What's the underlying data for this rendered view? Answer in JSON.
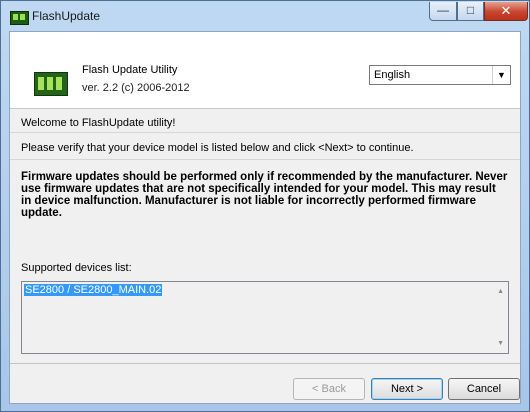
{
  "window": {
    "title": "FlashUpdate",
    "buttons": {
      "minimize": "—",
      "maximize": "□",
      "close": "✕"
    }
  },
  "header": {
    "title": "Flash Update Utility",
    "version": "ver. 2.2  (c) 2006-2012",
    "language": "English",
    "language_arrow": "▼"
  },
  "body": {
    "welcome": "Welcome to FlashUpdate utility!",
    "verify": "Please verify that your device model is listed below and click <Next> to continue.",
    "warning": "Firmware updates should be performed only if recommended by the manufacturer. Never use firmware updates that are not specifically intended for your model. This may result in device malfunction. Manufacturer is not liable for incorrectly performed firmware update.",
    "supported_label": "Supported devices list:",
    "devices": [
      "SE2800 / SE2800_MAIN.02"
    ],
    "scroll_up": "▲",
    "scroll_down": "▼"
  },
  "footer": {
    "back_label": "< Back",
    "next_label": "Next >",
    "cancel_label": "Cancel"
  },
  "colors": {
    "selection": "#3399ff",
    "close_button": "#c8452e"
  },
  "icons": [
    "app-chip-icon",
    "device-chip-icon",
    "dropdown-arrow-icon"
  ]
}
